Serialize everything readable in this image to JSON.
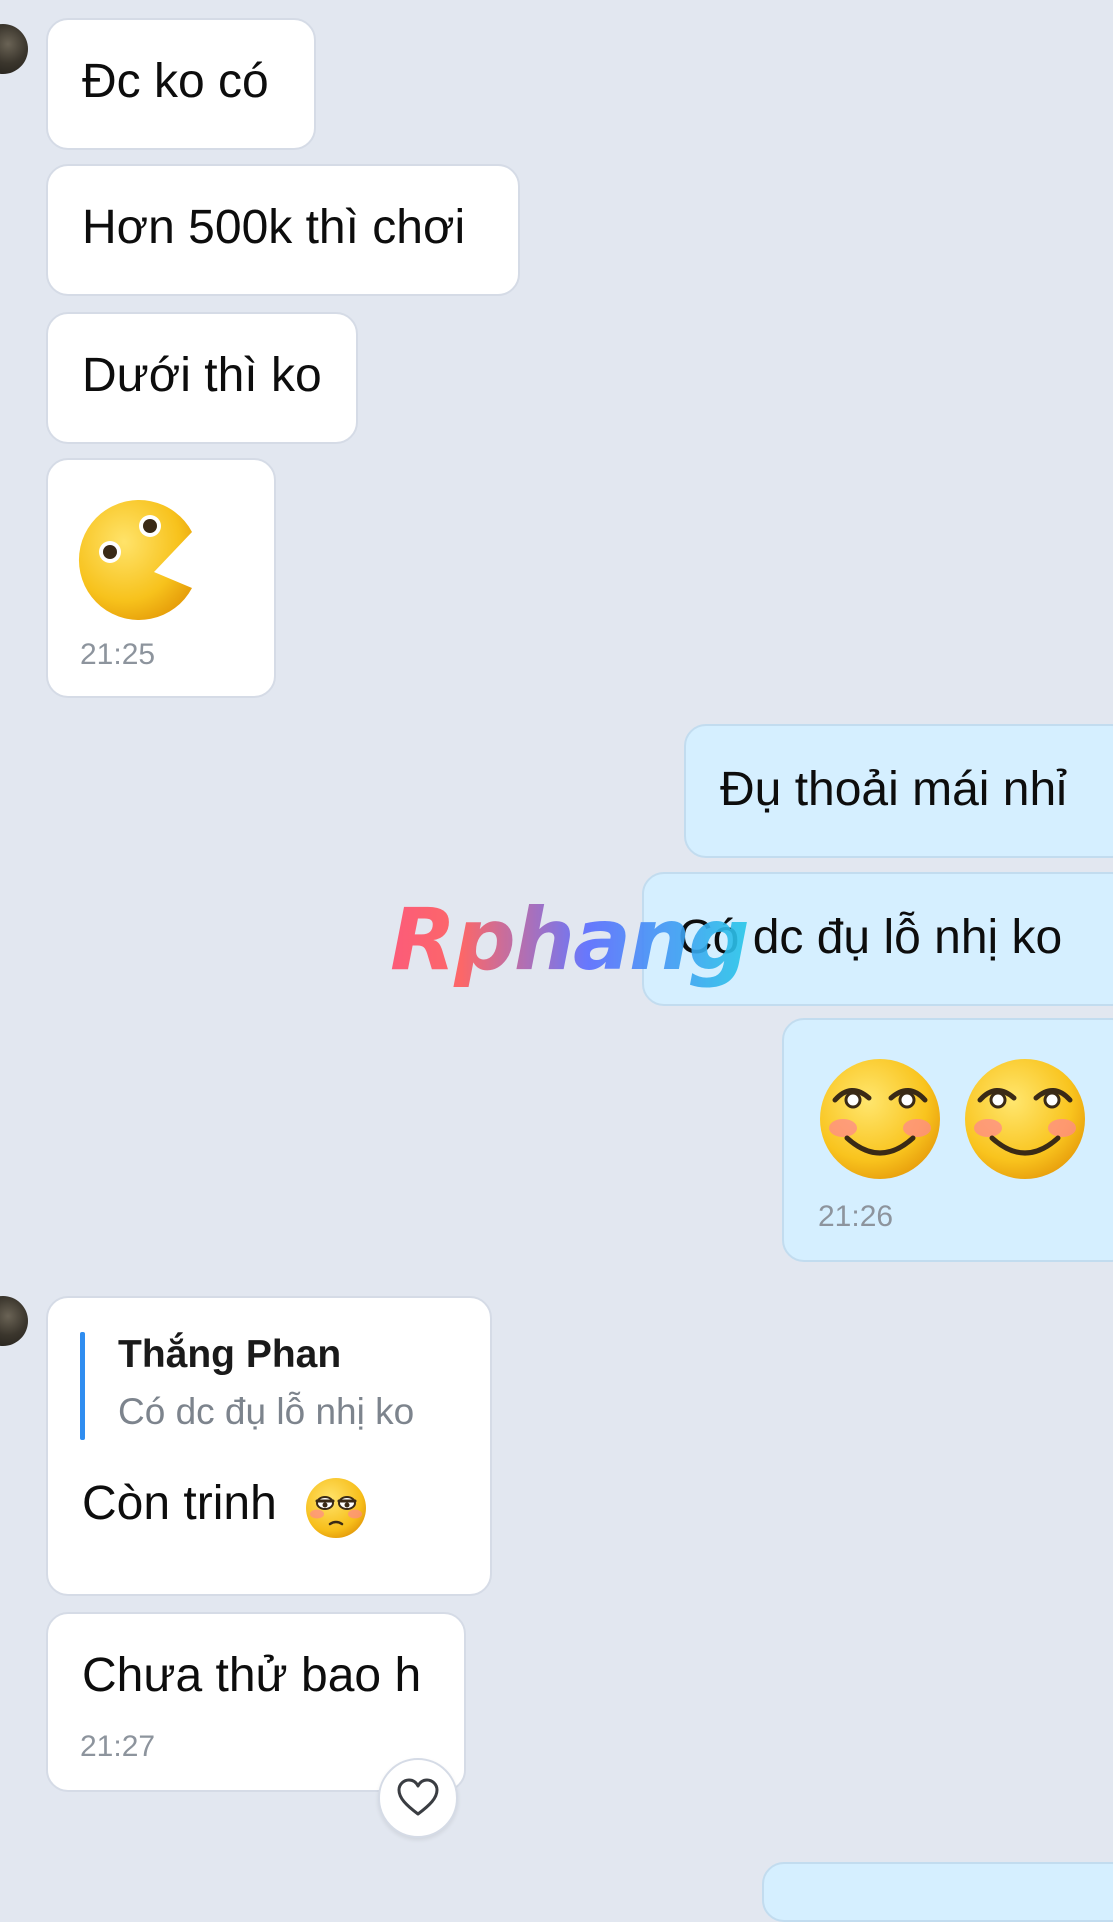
{
  "chat": {
    "messages": [
      {
        "sender": "other",
        "text": "Đc ko có"
      },
      {
        "sender": "other",
        "text": "Hơn 500k thì chơi"
      },
      {
        "sender": "other",
        "text": "Dưới thì ko"
      },
      {
        "sender": "other",
        "sticker": "pacman-face-sticker",
        "time": "21:25"
      },
      {
        "sender": "me",
        "text": "Đụ thoải mái nhỉ"
      },
      {
        "sender": "me",
        "text": "Có dc đụ lỗ nhị ko"
      },
      {
        "sender": "me",
        "sticker": "shy-smile-sticker",
        "time": "21:26"
      },
      {
        "sender": "other",
        "reply": {
          "name": "Thắng Phan",
          "text": "Có dc đụ lỗ nhị ko"
        },
        "text": "Còn trinh",
        "emoji": "tired-face-emoji"
      },
      {
        "sender": "other",
        "text": "Chưa thử bao h",
        "time": "21:27"
      }
    ],
    "reaction_icon": "heart-outline-icon"
  },
  "watermark": "Rphang",
  "colors": {
    "background": "#e2e7f0",
    "incoming_bubble": "#ffffff",
    "outgoing_bubble": "#d5efff",
    "quote_bar": "#2f8df0",
    "timestamp": "#8d949d"
  }
}
